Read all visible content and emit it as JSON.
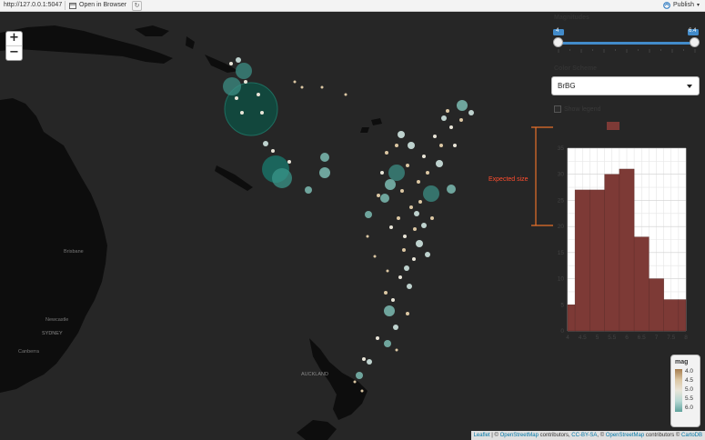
{
  "topbar": {
    "url": "http://127.0.0.1:5047",
    "open_in_browser_label": "Open in Browser",
    "publish_label": "Publish"
  },
  "map": {
    "place_labels": [
      "Brisbane",
      "Newcastle",
      "SYDNEY",
      "Canberra",
      "AUCKLAND"
    ],
    "zoom_in_label": "+",
    "zoom_out_label": "−"
  },
  "controls": {
    "magnitudes_label": "Magnitudes",
    "slider": {
      "min": 4,
      "max": 6.4,
      "low": 4,
      "high": 6.4,
      "low_label": "4",
      "high_label": "6.4"
    },
    "color_scheme_label": "Color Scheme",
    "color_scheme_value": "BrBG",
    "show_legend_label": "Show legend"
  },
  "annotation": {
    "expected_size_label": "Expected size"
  },
  "legend": {
    "title": "mag",
    "ticks": [
      "4.0",
      "4.5",
      "5.0",
      "5.5",
      "6.0"
    ],
    "colors": [
      "#a57d4e",
      "#dcc7a3",
      "#e9e5d8",
      "#b6d8d3",
      "#5fa39d"
    ]
  },
  "attribution": {
    "leaflet": "Leaflet",
    "osm1": "OpenStreetMap",
    "text1": " contributors, ",
    "ccbysa": "CC-BY-SA",
    "osm2": "OpenStreetMap",
    "text2": " contributors © ",
    "cartodb": "CartoDB"
  },
  "chart_data": {
    "type": "bar",
    "title": "",
    "legend_label": "",
    "xlabel": "",
    "ylabel": "",
    "bar_color": "#7d3a36",
    "x_edges": [
      4.0,
      4.25,
      4.5,
      4.75,
      5.0,
      5.25,
      5.5,
      5.75,
      6.0,
      6.25,
      6.5,
      6.75,
      7.0,
      7.25,
      7.5,
      7.75,
      8.0
    ],
    "bins": [
      [
        4.0,
        4.25
      ],
      [
        4.25,
        4.75
      ],
      [
        4.75,
        5.25
      ],
      [
        5.25,
        5.75
      ],
      [
        5.75,
        6.25
      ],
      [
        6.25,
        6.75
      ],
      [
        6.75,
        7.25
      ],
      [
        7.25,
        7.75
      ],
      [
        7.75,
        8.0
      ]
    ],
    "values": [
      5,
      27,
      27,
      30,
      31,
      18,
      10,
      6,
      6
    ],
    "xlim": [
      4,
      8
    ],
    "ylim": [
      0,
      35
    ],
    "xticks": [
      "4",
      "4.5",
      "5",
      "5.5",
      "6",
      "6.5",
      "7",
      "7.5",
      "8"
    ],
    "yticks": [
      "0",
      "5",
      "10",
      "15",
      "20",
      "25",
      "30",
      "35"
    ],
    "grid": true
  }
}
